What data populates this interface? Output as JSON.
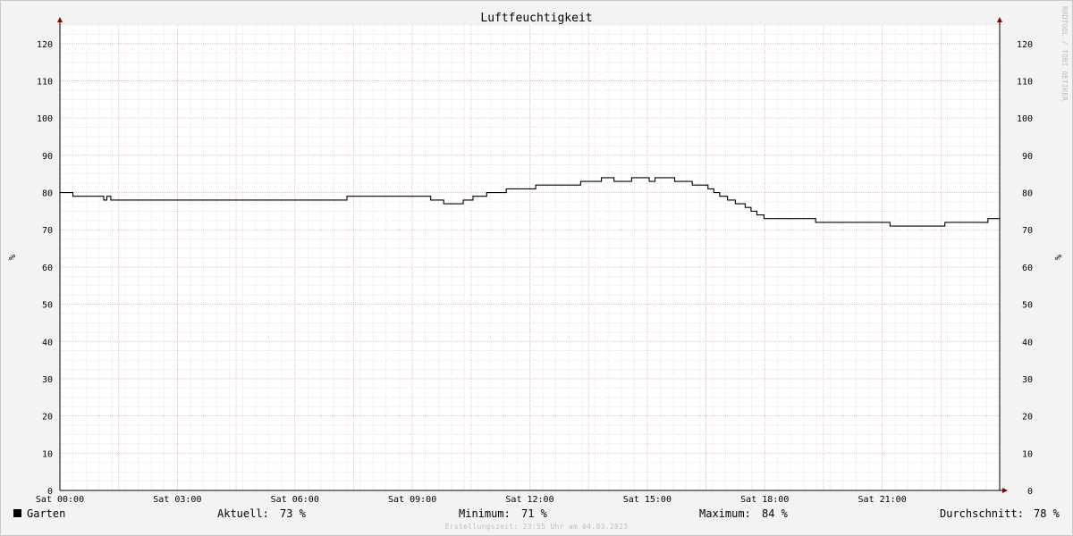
{
  "chart_data": {
    "type": "line",
    "title": "Luftfeuchtigkeit",
    "ylabel": "%",
    "ylabel_right": "%",
    "ylim": [
      0,
      125
    ],
    "xlim_hours": [
      0,
      24
    ],
    "y_ticks": [
      0,
      10,
      20,
      30,
      40,
      50,
      60,
      70,
      80,
      90,
      100,
      110,
      120
    ],
    "x_ticks": [
      {
        "hour": 0,
        "label": "Sat 00:00"
      },
      {
        "hour": 3,
        "label": "Sat 03:00"
      },
      {
        "hour": 6,
        "label": "Sat 06:00"
      },
      {
        "hour": 9,
        "label": "Sat 09:00"
      },
      {
        "hour": 12,
        "label": "Sat 12:00"
      },
      {
        "hour": 15,
        "label": "Sat 15:00"
      },
      {
        "hour": 18,
        "label": "Sat 18:00"
      },
      {
        "hour": 21,
        "label": "Sat 21:00"
      }
    ],
    "grid": true,
    "legend_position": "bottom-left",
    "series": [
      {
        "name": "Garten",
        "color": "#000000",
        "points": [
          [
            0.0,
            80
          ],
          [
            0.33,
            79
          ],
          [
            1.12,
            78
          ],
          [
            1.2,
            79
          ],
          [
            1.3,
            78
          ],
          [
            7.33,
            79
          ],
          [
            9.47,
            78
          ],
          [
            9.8,
            77
          ],
          [
            10.3,
            78
          ],
          [
            10.55,
            79
          ],
          [
            10.9,
            80
          ],
          [
            11.4,
            81
          ],
          [
            12.15,
            82
          ],
          [
            13.3,
            83
          ],
          [
            13.83,
            84
          ],
          [
            14.15,
            83
          ],
          [
            14.6,
            84
          ],
          [
            15.05,
            83
          ],
          [
            15.2,
            84
          ],
          [
            15.7,
            83
          ],
          [
            16.15,
            82
          ],
          [
            16.55,
            81
          ],
          [
            16.7,
            80
          ],
          [
            16.85,
            79
          ],
          [
            17.05,
            78
          ],
          [
            17.25,
            77
          ],
          [
            17.5,
            76
          ],
          [
            17.65,
            75
          ],
          [
            17.8,
            74
          ],
          [
            17.98,
            73
          ],
          [
            19.3,
            72
          ],
          [
            21.2,
            71
          ],
          [
            22.6,
            72
          ],
          [
            23.7,
            73
          ],
          [
            24.0,
            73
          ]
        ]
      }
    ]
  },
  "watermark": "RRDTOOL / TOBI OETIKER",
  "legend": {
    "series_name": "Garten",
    "current_label": "Aktuell:",
    "current_value": "73 %",
    "min_label": "Minimum:",
    "min_value": "71 %",
    "max_label": "Maximum:",
    "max_value": "84 %",
    "avg_label": "Durchschnitt:",
    "avg_value": "78 %"
  },
  "created_text": "Erstellungszeit: 23:55 Uhr am 04.03.2023"
}
